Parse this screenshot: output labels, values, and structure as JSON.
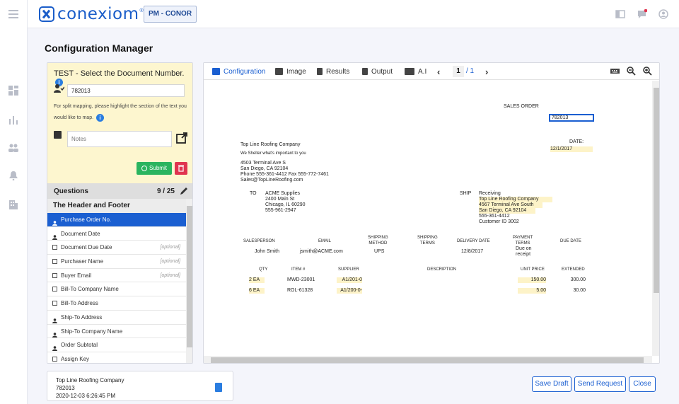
{
  "brand": {
    "logo_text": "conexiom",
    "logo_mark": "®"
  },
  "header": {
    "badge": "PM - CONOR"
  },
  "page": {
    "title": "Configuration Manager"
  },
  "config": {
    "doc_title": "TEST - Select the Document Number.",
    "info_glyph": "i",
    "doc_number": "782013",
    "split_help": "For split mapping, please highlight the section of the text you would like to map.",
    "notes_placeholder": "Notes",
    "submit_label": "Submit"
  },
  "questions": {
    "title": "Questions",
    "count": "9 / 25",
    "section": "The Header and Footer",
    "items": [
      {
        "label": "Purchase Order No.",
        "optional": "",
        "mark": "person-icon",
        "active": true
      },
      {
        "label": "Document Date",
        "optional": "",
        "mark": "person-icon",
        "active": false
      },
      {
        "label": "Document Due Date",
        "optional": "[optional]",
        "mark": "checkbox",
        "active": false
      },
      {
        "label": "Purchaser Name",
        "optional": "[optional]",
        "mark": "checkbox",
        "active": false
      },
      {
        "label": "Buyer Email",
        "optional": "[optional]",
        "mark": "checkbox",
        "active": false
      },
      {
        "label": "Bill-To Company Name",
        "optional": "",
        "mark": "checkbox",
        "active": false
      },
      {
        "label": "Bill-To Address",
        "optional": "",
        "mark": "checkbox",
        "active": false
      },
      {
        "label": "Ship-To Address",
        "optional": "",
        "mark": "person-icon",
        "active": false
      },
      {
        "label": "Ship-To Company Name",
        "optional": "",
        "mark": "person-icon",
        "active": false
      },
      {
        "label": "Order Subtotal",
        "optional": "",
        "mark": "person-icon",
        "active": false
      },
      {
        "label": "Assign Key",
        "optional": "",
        "mark": "checkbox",
        "active": false
      }
    ]
  },
  "viewer": {
    "tabs": [
      "Configuration",
      "Image",
      "Results",
      "Output",
      "A.I"
    ],
    "page_current": "1",
    "page_total": "/ 1"
  },
  "document": {
    "sales_order": "SALES ORDER",
    "order_number": "782013",
    "company": "Top Line Roofing Company",
    "tagline": "We Shelter what's important to you",
    "addr1": "4503 Terminal Ave S",
    "addr2": "San Diego, CA 92104",
    "phone": "Phone 555-361-4412 Fax 555-772-7461",
    "email": "Sales@TopLineRoofing.com",
    "date_label": "DATE:",
    "date": "12/1/2017",
    "to_label": "TO",
    "to_lines": [
      "ACME Supplies",
      "2400 Main St",
      "Chicago, IL 60290",
      "555-961-2947"
    ],
    "ship_label": "SHIP",
    "ship_receiving": "Receiving",
    "ship_lines": [
      "Top Line Roofing Company",
      "4567 Terminal Ave South",
      "San Diego, CA 92104"
    ],
    "ship_extra": [
      "555-361-4412",
      "Customer ID 3002"
    ],
    "col_salesperson": "SALESPERSON",
    "col_email": "EMAIL",
    "col_ship_method": "SHIPPING\nMETHOD",
    "col_ship_terms": "SHIPPING\nTERMS",
    "col_delivery": "DELIVERY DATE",
    "col_payment": "PAYMENT\nTERMS",
    "col_due": "DUE DATE",
    "salesperson": "John Smith",
    "sp_email": "jsmith@ACME.com",
    "ship_method": "UPS",
    "delivery_date": "12/8/2017",
    "payment_terms": "Due on\nreceipt",
    "col_qty": "QTY",
    "col_item": "ITEM #",
    "col_supplier": "SUPPLIER",
    "col_desc": "DESCRIPTION",
    "col_unit": "UNIT PRICE",
    "col_ext": "EXTENDED",
    "lines": [
      {
        "qty": "2 EA",
        "item": "MWD-23001",
        "supplier": "A1/201-0",
        "unit": "150.00",
        "ext": "300.00"
      },
      {
        "qty": "6 EA",
        "item": "ROL-61328",
        "supplier": "A1/200-0-",
        "unit": "5.00",
        "ext": "30.00"
      }
    ]
  },
  "footer_card": {
    "company": "Top Line Roofing Company",
    "number": "782013",
    "timestamp": "2020-12-03 6:26:45 PM"
  },
  "actions": {
    "save_draft": "Save Draft",
    "send_request": "Send Request",
    "close": "Close"
  },
  "colors": {
    "accent": "#1b5fd1",
    "submit": "#2ab45f",
    "danger": "#e0344f",
    "highlight": "#fdf3c8",
    "panel_yellow": "#fdf6cf"
  }
}
